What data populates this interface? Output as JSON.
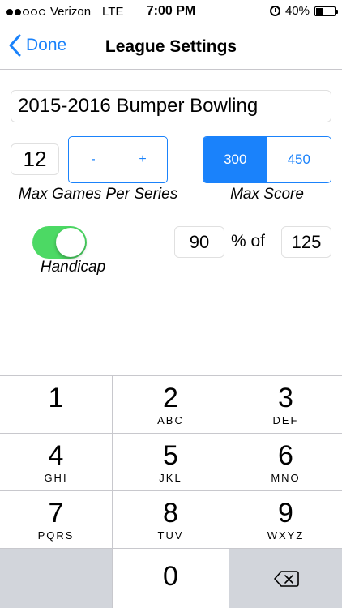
{
  "status_bar": {
    "carrier": "Verizon",
    "network": "LTE",
    "time": "7:00 PM",
    "battery": "40%",
    "battery_level": 0.4,
    "signal_filled": 2,
    "signal_total": 5
  },
  "nav": {
    "back_label": "Done",
    "title": "League Settings"
  },
  "league": {
    "name": "2015-2016 Bumper Bowling"
  },
  "max_games": {
    "value": "12",
    "minus_label": "-",
    "plus_label": "+",
    "caption": "Max Games Per Series"
  },
  "max_score": {
    "options": [
      "300",
      "450"
    ],
    "selected": "300",
    "caption": "Max Score"
  },
  "handicap": {
    "enabled": true,
    "caption": "Handicap",
    "percent": "90",
    "percent_of_label": "% of",
    "base": "125"
  },
  "keypad": {
    "keys": [
      {
        "num": "1",
        "letters": ""
      },
      {
        "num": "2",
        "letters": "ABC"
      },
      {
        "num": "3",
        "letters": "DEF"
      },
      {
        "num": "4",
        "letters": "GHI"
      },
      {
        "num": "5",
        "letters": "JKL"
      },
      {
        "num": "6",
        "letters": "MNO"
      },
      {
        "num": "7",
        "letters": "PQRS"
      },
      {
        "num": "8",
        "letters": "TUV"
      },
      {
        "num": "9",
        "letters": "WXYZ"
      },
      {
        "num": "0",
        "letters": ""
      }
    ]
  },
  "colors": {
    "accent": "#1a82fb",
    "toggle_on": "#4cd964",
    "keypad_gray": "#d2d5db"
  }
}
